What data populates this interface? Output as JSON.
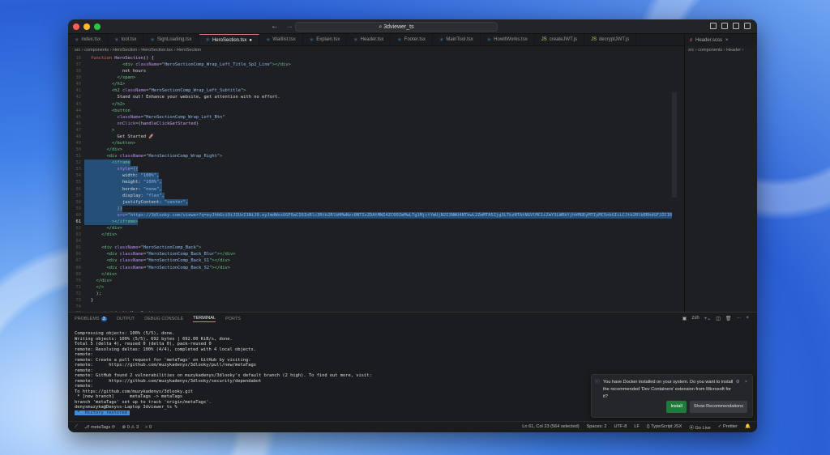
{
  "window": {
    "title": "3dviewer_ts"
  },
  "tabs": [
    {
      "label": "index.tsx",
      "icon": "tsx"
    },
    {
      "label": "tool.tsx",
      "icon": "tsx"
    },
    {
      "label": "SignLoading.tsx",
      "icon": "tsx"
    },
    {
      "label": "HeroSection.tsx",
      "icon": "tsx",
      "active": true,
      "modified": "●"
    },
    {
      "label": "Waitlist.tsx",
      "icon": "tsx"
    },
    {
      "label": "Explain.tsx",
      "icon": "tsx"
    },
    {
      "label": "Header.tsx",
      "icon": "tsx"
    },
    {
      "label": "Footer.tsx",
      "icon": "tsx"
    },
    {
      "label": "MainTool.tsx",
      "icon": "tsx"
    },
    {
      "label": "HowItWorks.tsx",
      "icon": "tsx"
    },
    {
      "label": "createJWT.js",
      "icon": "js"
    },
    {
      "label": "decryptJWT.js",
      "icon": "js"
    }
  ],
  "right_tab": {
    "label": "Header.scss"
  },
  "breadcrumb": "src › components › HeroSection › HeroSection.tsx › HeroSection",
  "right_breadcrumb": "src › components › Header ›",
  "code": [
    {
      "n": "16",
      "t": [
        [
          "kw",
          "function "
        ],
        [
          "fn",
          "HeroSection"
        ],
        [
          "tx",
          "() {"
        ]
      ]
    },
    {
      "n": "37",
      "t": [
        [
          "tx",
          "            "
        ],
        [
          "tg",
          "<div "
        ],
        [
          "at",
          "className"
        ],
        [
          "pu",
          "="
        ],
        [
          "st",
          "\"HeroSectionComp_Wrap_Left_Title_Sp2_Line\""
        ],
        [
          "tg",
          "></div>"
        ]
      ]
    },
    {
      "n": "38",
      "t": [
        [
          "tx",
          "            not hours"
        ]
      ]
    },
    {
      "n": "39",
      "t": [
        [
          "tx",
          "          "
        ],
        [
          "tg",
          "</span>"
        ]
      ]
    },
    {
      "n": "40",
      "t": [
        [
          "tx",
          "        "
        ],
        [
          "tg",
          "</h1>"
        ]
      ]
    },
    {
      "n": "41",
      "t": [
        [
          "tx",
          "        "
        ],
        [
          "tg",
          "<h2 "
        ],
        [
          "at",
          "className"
        ],
        [
          "pu",
          "="
        ],
        [
          "st",
          "\"HeroSectionComp_Wrap_Left_Subtitle\""
        ],
        [
          "tg",
          ">"
        ]
      ]
    },
    {
      "n": "42",
      "t": [
        [
          "tx",
          "          Stand out! Enhance your website, get attention with no effort."
        ]
      ]
    },
    {
      "n": "43",
      "t": [
        [
          "tx",
          "        "
        ],
        [
          "tg",
          "</h2>"
        ]
      ]
    },
    {
      "n": "44",
      "t": [
        [
          "tx",
          "        "
        ],
        [
          "tg",
          "<button"
        ]
      ]
    },
    {
      "n": "45",
      "t": [
        [
          "tx",
          "          "
        ],
        [
          "at",
          "className"
        ],
        [
          "pu",
          "="
        ],
        [
          "st",
          "\"HeroSectionComp_Wrap_Left_Btn\""
        ]
      ]
    },
    {
      "n": "46",
      "t": [
        [
          "tx",
          "          "
        ],
        [
          "at",
          "onClick"
        ],
        [
          "pu",
          "={"
        ],
        [
          "fn",
          "handleClickGetStarted"
        ],
        [
          "pu",
          "}"
        ]
      ]
    },
    {
      "n": "47",
      "t": [
        [
          "tx",
          "        "
        ],
        [
          "tg",
          ">"
        ]
      ]
    },
    {
      "n": "48",
      "t": [
        [
          "tx",
          "          Get Started 🚀"
        ]
      ]
    },
    {
      "n": "49",
      "t": [
        [
          "tx",
          "        "
        ],
        [
          "tg",
          "</button>"
        ]
      ]
    },
    {
      "n": "50",
      "t": [
        [
          "tx",
          "      "
        ],
        [
          "tg",
          "</div>"
        ]
      ]
    },
    {
      "n": "51",
      "t": [
        [
          "tx",
          "      "
        ],
        [
          "tg",
          "<div "
        ],
        [
          "at",
          "className"
        ],
        [
          "pu",
          "="
        ],
        [
          "st",
          "\"HeroSectionComp_Wrap_Right\""
        ],
        [
          "tg",
          ">"
        ]
      ]
    },
    {
      "n": "52",
      "sel": true,
      "t": [
        [
          "tx",
          "        "
        ],
        [
          "tg",
          "<iframe"
        ]
      ]
    },
    {
      "n": "53",
      "sel": true,
      "t": [
        [
          "tx",
          "          "
        ],
        [
          "at",
          "style"
        ],
        [
          "pu",
          "={{"
        ]
      ]
    },
    {
      "n": "54",
      "sel": true,
      "t": [
        [
          "tx",
          "            width: "
        ],
        [
          "st",
          "\"100%\""
        ],
        [
          "tx",
          ","
        ]
      ]
    },
    {
      "n": "55",
      "sel": true,
      "t": [
        [
          "tx",
          "            height: "
        ],
        [
          "st",
          "\"100%\""
        ],
        [
          "tx",
          ","
        ]
      ]
    },
    {
      "n": "56",
      "sel": true,
      "t": [
        [
          "tx",
          "            border: "
        ],
        [
          "st",
          "\"none\""
        ],
        [
          "tx",
          ","
        ]
      ]
    },
    {
      "n": "57",
      "sel": true,
      "t": [
        [
          "tx",
          "            display: "
        ],
        [
          "st",
          "\"flex\""
        ],
        [
          "tx",
          ","
        ]
      ]
    },
    {
      "n": "58",
      "sel": true,
      "t": [
        [
          "tx",
          "            justifyContent: "
        ],
        [
          "st",
          "\"center\""
        ],
        [
          "tx",
          ","
        ]
      ]
    },
    {
      "n": "59",
      "sel": true,
      "t": [
        [
          "tx",
          "          "
        ],
        [
          "pu",
          "}}"
        ]
      ]
    },
    {
      "n": "60",
      "sel": true,
      "t": [
        [
          "tx",
          "          "
        ],
        [
          "at",
          "src"
        ],
        [
          "pu",
          "="
        ],
        [
          "st",
          "\"https://3dlooky.com/viewer?q=eyJhbGciOiJIUzI1NiJ9.eyJmdWxsUGF0aCI6InRlc3Rtb2RlbHMwNzc0NTIzZDAtMWI4ZC00ZmMwLTg1MjctYmUjN2I3NWU4NTkwL2ZmMTA5Zjg3LTkzNTAtNGVlMC1iZmY3LWRkYjhhMGEyMTIyMC5nbGIiLCJtb2RlbERhdGFJZCI6"
        ]
      ]
    },
    {
      "n": "61",
      "sel": true,
      "cur": true,
      "t": [
        [
          "tx",
          "        "
        ],
        [
          "tg",
          "></iframe>"
        ]
      ]
    },
    {
      "n": "62",
      "t": [
        [
          "tx",
          "      "
        ],
        [
          "tg",
          "</div>"
        ]
      ]
    },
    {
      "n": "63",
      "t": [
        [
          "tx",
          "    "
        ],
        [
          "tg",
          "</div>"
        ]
      ]
    },
    {
      "n": "64",
      "t": []
    },
    {
      "n": "65",
      "t": [
        [
          "tx",
          "    "
        ],
        [
          "tg",
          "<div "
        ],
        [
          "at",
          "className"
        ],
        [
          "pu",
          "="
        ],
        [
          "st",
          "\"HeroSectionComp_Back\""
        ],
        [
          "tg",
          ">"
        ]
      ]
    },
    {
      "n": "66",
      "t": [
        [
          "tx",
          "      "
        ],
        [
          "tg",
          "<div "
        ],
        [
          "at",
          "className"
        ],
        [
          "pu",
          "="
        ],
        [
          "st",
          "\"HeroSectionComp_Back_Blur\""
        ],
        [
          "tg",
          "></div>"
        ]
      ]
    },
    {
      "n": "67",
      "t": [
        [
          "tx",
          "      "
        ],
        [
          "tg",
          "<div "
        ],
        [
          "at",
          "className"
        ],
        [
          "pu",
          "="
        ],
        [
          "st",
          "\"HeroSectionComp_Back_S1\""
        ],
        [
          "tg",
          "></div>"
        ]
      ]
    },
    {
      "n": "68",
      "t": [
        [
          "tx",
          "      "
        ],
        [
          "tg",
          "<div "
        ],
        [
          "at",
          "className"
        ],
        [
          "pu",
          "="
        ],
        [
          "st",
          "\"HeroSectionComp_Back_S2\""
        ],
        [
          "tg",
          "></div>"
        ]
      ]
    },
    {
      "n": "69",
      "t": [
        [
          "tx",
          "    "
        ],
        [
          "tg",
          "</div>"
        ]
      ]
    },
    {
      "n": "70",
      "t": [
        [
          "tx",
          "  "
        ],
        [
          "tg",
          "</div>"
        ]
      ]
    },
    {
      "n": "71",
      "t": [
        [
          "tx",
          "  "
        ],
        [
          "tg",
          "</>"
        ]
      ]
    },
    {
      "n": "72",
      "t": [
        [
          "tx",
          "  );"
        ]
      ]
    },
    {
      "n": "73",
      "t": [
        [
          "tx",
          "}"
        ]
      ]
    },
    {
      "n": "74",
      "t": []
    },
    {
      "n": "75",
      "t": [
        [
          "kw",
          "export default "
        ],
        [
          "fn",
          "HeroSection"
        ],
        [
          "tx",
          ";"
        ]
      ]
    }
  ],
  "panel": {
    "tabs": [
      "PROBLEMS",
      "OUTPUT",
      "DEBUG CONSOLE",
      "TERMINAL",
      "PORTS"
    ],
    "problems_count": "3",
    "shell": "zsh"
  },
  "terminal": [
    "Compressing objects: 100% (5/5), done.",
    "Writing objects: 100% (5/5), 692 bytes | 692.00 KiB/s, done.",
    "Total 5 (delta 4), reused 0 (delta 0), pack-reused 0",
    "remote: Resolving deltas: 100% (4/4), completed with 4 local objects.",
    "remote:",
    "remote: Create a pull request for 'metaTags' on GitHub by visiting:",
    "remote:      https://github.com/muzykadenys/3dlooky/pull/new/metaTags",
    "remote:",
    "remote: GitHub found 2 vulnerabilities on muzykadenys/3dlooky's default branch (2 high). To find out more, visit:",
    "remote:      https://github.com/muzykadenys/3dlooky/security/dependabot",
    "remote:",
    "To https://github.com/muzykadenys/3dlooky.git",
    " * [new branch]      metaTags -> metaTags",
    "branch 'metaTags' set up to track 'origin/metaTags'.",
    "denysmuzyka@Denyss-Laptop 3dviewer_ts %"
  ],
  "history_restored": " *  History restored ",
  "prompt": "denysmuzyka@Denyss-Laptop 3dviewer_ts %",
  "notification": {
    "message": "You have Docker installed on your system. Do you want to install the recommended 'Dev Containers' extension from Microsoft for it?",
    "install": "Install",
    "show": "Show Recommendations"
  },
  "status": {
    "branch": "metaTags",
    "errors": "0",
    "warnings": "3",
    "ports": "0",
    "position": "Ln 61, Col 23 (564 selected)",
    "spaces": "Spaces: 2",
    "encoding": "UTF-8",
    "eol": "LF",
    "language": "TypeScript JSX",
    "golive": "Go Live",
    "prettier": "Prettier"
  }
}
